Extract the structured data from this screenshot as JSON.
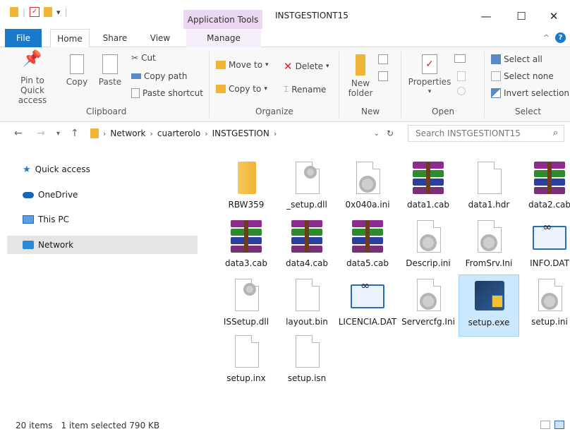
{
  "window": {
    "title": "INSTGESTIONT15",
    "context_tab": "Application Tools",
    "minimize": "—",
    "maximize": "☐",
    "close": "✕"
  },
  "tabs": [
    {
      "label": "File"
    },
    {
      "label": "Home"
    },
    {
      "label": "Share"
    },
    {
      "label": "View"
    },
    {
      "label": "Manage"
    }
  ],
  "ribbon": {
    "clipboard": {
      "label": "Clipboard",
      "pin": "Pin to Quick access",
      "copy": "Copy",
      "paste": "Paste",
      "cut": "Cut",
      "copy_path": "Copy path",
      "paste_shortcut": "Paste shortcut"
    },
    "organize": {
      "label": "Organize",
      "move_to": "Move to",
      "copy_to": "Copy to",
      "delete": "Delete",
      "rename": "Rename"
    },
    "new": {
      "label": "New",
      "new_folder": "New folder"
    },
    "open": {
      "label": "Open",
      "properties": "Properties"
    },
    "select": {
      "label": "Select",
      "select_all": "Select all",
      "select_none": "Select none",
      "invert_selection": "Invert selection"
    }
  },
  "address": {
    "crumbs": [
      "Network",
      "cuarterolo",
      "INSTGESTION"
    ],
    "search_placeholder": "Search INSTGESTIONT15"
  },
  "nav": {
    "items": [
      {
        "label": "Quick access"
      },
      {
        "label": "OneDrive"
      },
      {
        "label": "This PC"
      },
      {
        "label": "Network"
      }
    ]
  },
  "files": [
    {
      "name": "RBW359",
      "icon": "folder-icon"
    },
    {
      "name": "_setup.dll",
      "icon": "dll-icon"
    },
    {
      "name": "0x040a.ini",
      "icon": "ini-icon"
    },
    {
      "name": "data1.cab",
      "icon": "rar-icon"
    },
    {
      "name": "data1.hdr",
      "icon": "file-icon"
    },
    {
      "name": "data2.cab",
      "icon": "rar-icon"
    },
    {
      "name": "data3.cab",
      "icon": "rar-icon"
    },
    {
      "name": "data4.cab",
      "icon": "rar-icon"
    },
    {
      "name": "data5.cab",
      "icon": "rar-icon"
    },
    {
      "name": "Descrip.ini",
      "icon": "ini-icon"
    },
    {
      "name": "FromSrv.Ini",
      "icon": "ini-icon"
    },
    {
      "name": "INFO.DAT",
      "icon": "mail-icon"
    },
    {
      "name": "ISSetup.dll",
      "icon": "dll-icon"
    },
    {
      "name": "layout.bin",
      "icon": "file-icon"
    },
    {
      "name": "LICENCIA.DAT",
      "icon": "mail-icon"
    },
    {
      "name": "Servercfg.Ini",
      "icon": "ini-icon"
    },
    {
      "name": "setup.exe",
      "icon": "setup-icon"
    },
    {
      "name": "setup.ini",
      "icon": "ini-icon"
    },
    {
      "name": "setup.inx",
      "icon": "file-icon"
    },
    {
      "name": "setup.isn",
      "icon": "file-icon"
    }
  ],
  "status": {
    "count": "20 items",
    "selection": "1 item selected  790 KB"
  }
}
